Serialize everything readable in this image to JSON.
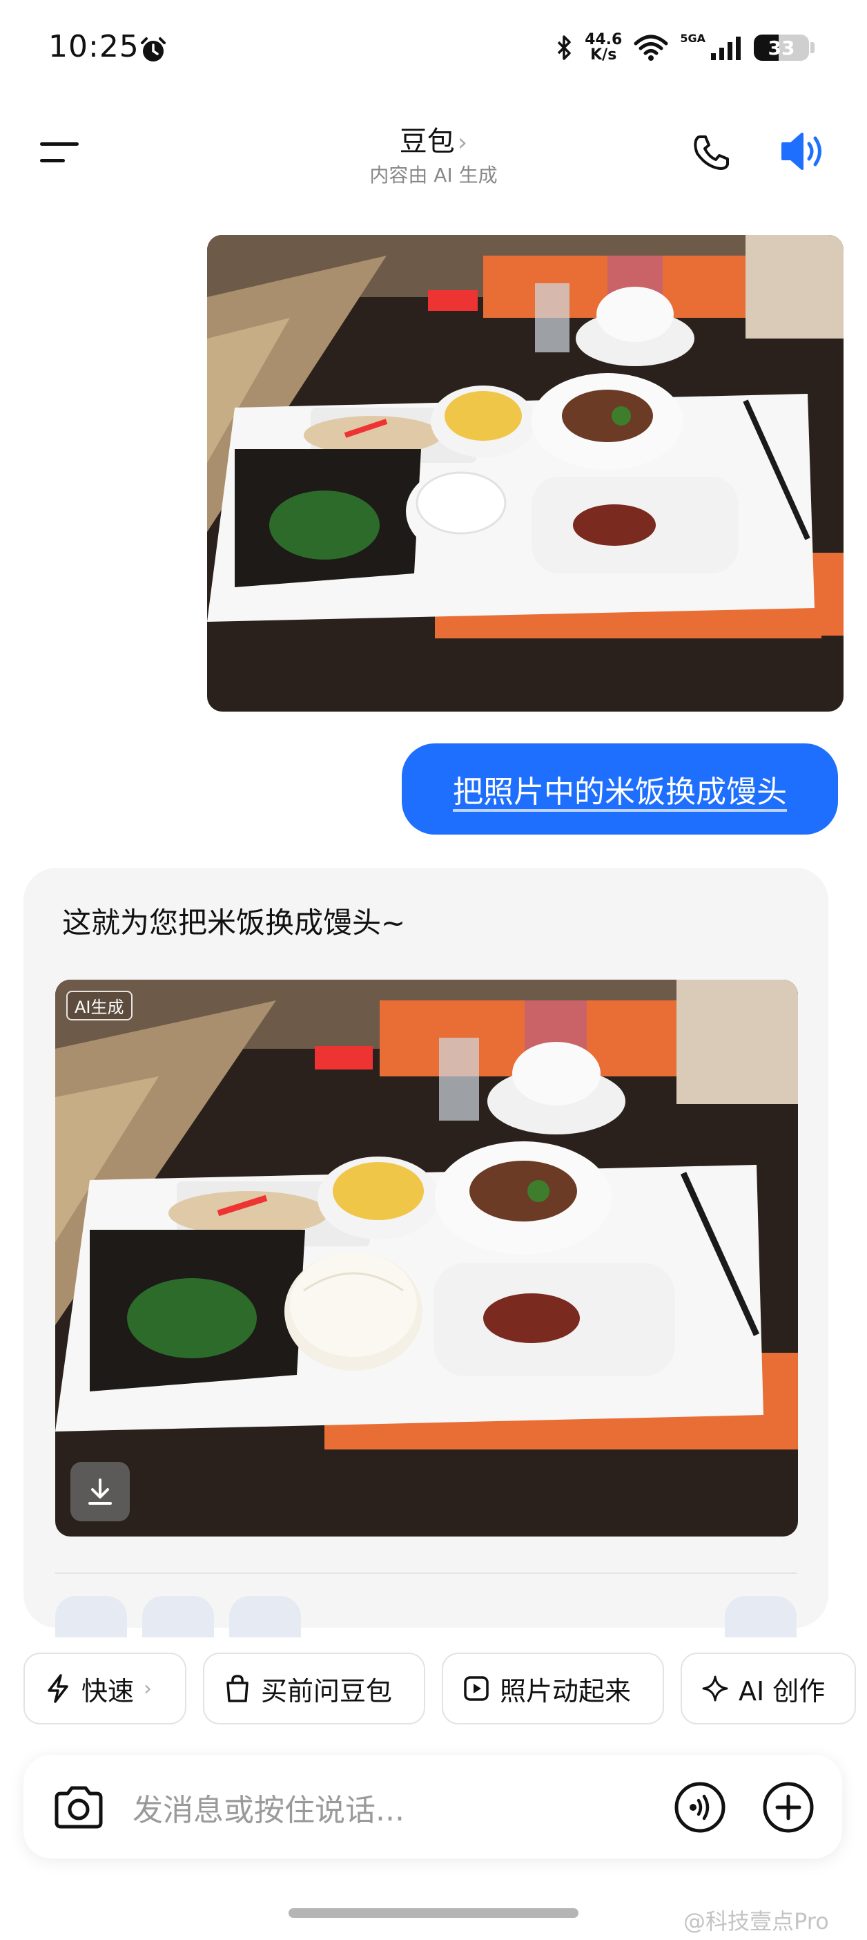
{
  "status_bar": {
    "time": "10:25",
    "net_speed_value": "44.6",
    "net_speed_unit": "K/s",
    "signal_label": "5GA",
    "battery": "33"
  },
  "header": {
    "title": "豆包",
    "subtitle": "内容由 AI 生成"
  },
  "conversation": {
    "user_message": "把照片中的米饭换成馒头",
    "assistant_message": "这就为您把米饭换成馒头~",
    "ai_badge": "AI生成"
  },
  "quick_chips": [
    {
      "label": "快速",
      "icon": "bolt-icon"
    },
    {
      "label": "买前问豆包",
      "icon": "shopping-bag-icon"
    },
    {
      "label": "照片动起来",
      "icon": "play-icon"
    },
    {
      "label": "AI 创作",
      "icon": "sparkle-icon"
    }
  ],
  "input": {
    "placeholder": "发消息或按住说话..."
  },
  "watermark": "@科技壹点Pro",
  "colors": {
    "accent": "#1f6fff",
    "tray": "#ffffff",
    "table": "#2a211c",
    "placemat": "#f0713a"
  }
}
